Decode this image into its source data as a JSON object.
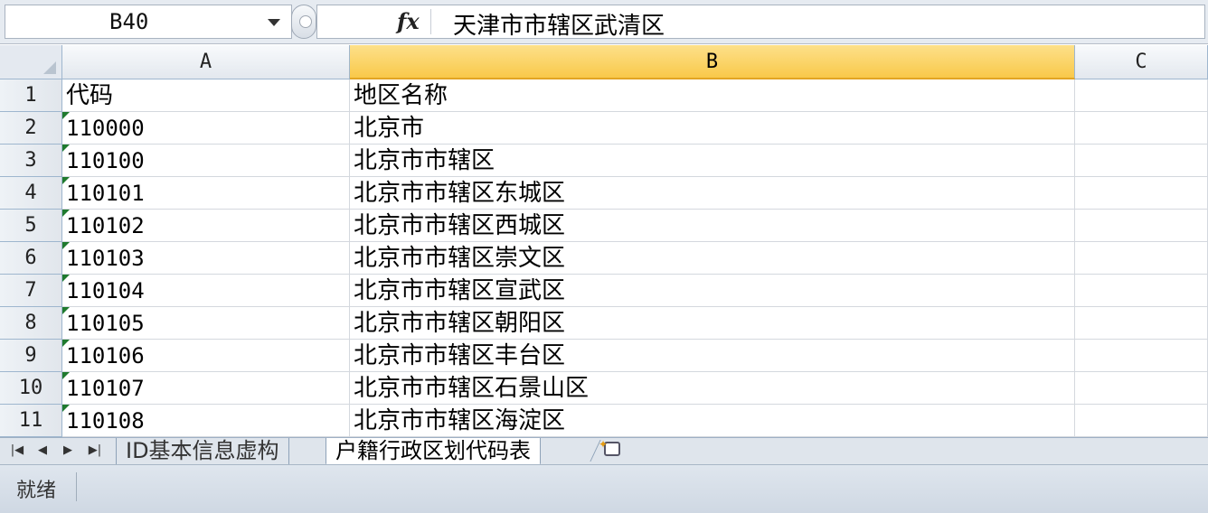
{
  "name_box": {
    "value": "B40"
  },
  "formula_bar": {
    "fx_label": "fx",
    "value": "天津市市辖区武清区"
  },
  "columns": [
    "A",
    "B",
    "C"
  ],
  "rows": [
    {
      "num": "1",
      "a": "代码",
      "b": "地区名称",
      "flag": false
    },
    {
      "num": "2",
      "a": "110000",
      "b": "北京市",
      "flag": true
    },
    {
      "num": "3",
      "a": "110100",
      "b": "北京市市辖区",
      "flag": true
    },
    {
      "num": "4",
      "a": "110101",
      "b": "北京市市辖区东城区",
      "flag": true
    },
    {
      "num": "5",
      "a": "110102",
      "b": "北京市市辖区西城区",
      "flag": true
    },
    {
      "num": "6",
      "a": "110103",
      "b": "北京市市辖区崇文区",
      "flag": true
    },
    {
      "num": "7",
      "a": "110104",
      "b": "北京市市辖区宣武区",
      "flag": true
    },
    {
      "num": "8",
      "a": "110105",
      "b": "北京市市辖区朝阳区",
      "flag": true
    },
    {
      "num": "9",
      "a": "110106",
      "b": "北京市市辖区丰台区",
      "flag": true
    },
    {
      "num": "10",
      "a": "110107",
      "b": "北京市市辖区石景山区",
      "flag": true
    },
    {
      "num": "11",
      "a": "110108",
      "b": "北京市市辖区海淀区",
      "flag": true
    }
  ],
  "sheet_tabs": [
    {
      "label": "ID基本信息虚构",
      "active": false
    },
    {
      "label": "户籍行政区划代码表",
      "active": true
    }
  ],
  "nav_buttons": [
    "first-sheet",
    "prev-sheet",
    "next-sheet",
    "last-sheet"
  ],
  "status": {
    "text": "就绪"
  },
  "colors": {
    "active_header": "#f9c94a",
    "green_flag": "#1f7a2e"
  }
}
